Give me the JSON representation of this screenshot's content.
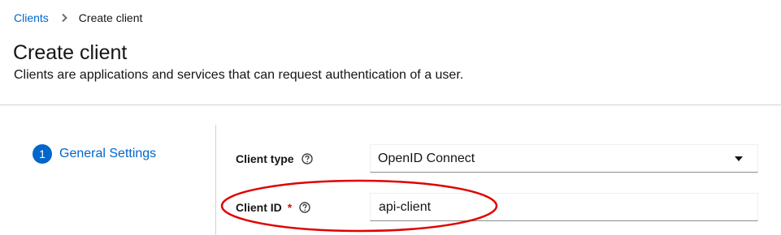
{
  "breadcrumb": {
    "parent": "Clients",
    "current": "Create client"
  },
  "header": {
    "title": "Create client",
    "subtitle": "Clients are applications and services that can request authentication of a user."
  },
  "wizard": {
    "steps": [
      {
        "number": "1",
        "label": "General Settings"
      }
    ]
  },
  "form": {
    "client_type": {
      "label": "Client type",
      "value": "OpenID Connect"
    },
    "client_id": {
      "label": "Client ID",
      "required_marker": "*",
      "value": "api-client"
    }
  },
  "colors": {
    "link": "#0066cc",
    "required": "#c9190b",
    "annotation": "#e00000"
  },
  "icons": {
    "breadcrumb_separator": "chevron-right-icon",
    "help": "help-circle-icon",
    "dropdown": "caret-down-icon"
  }
}
